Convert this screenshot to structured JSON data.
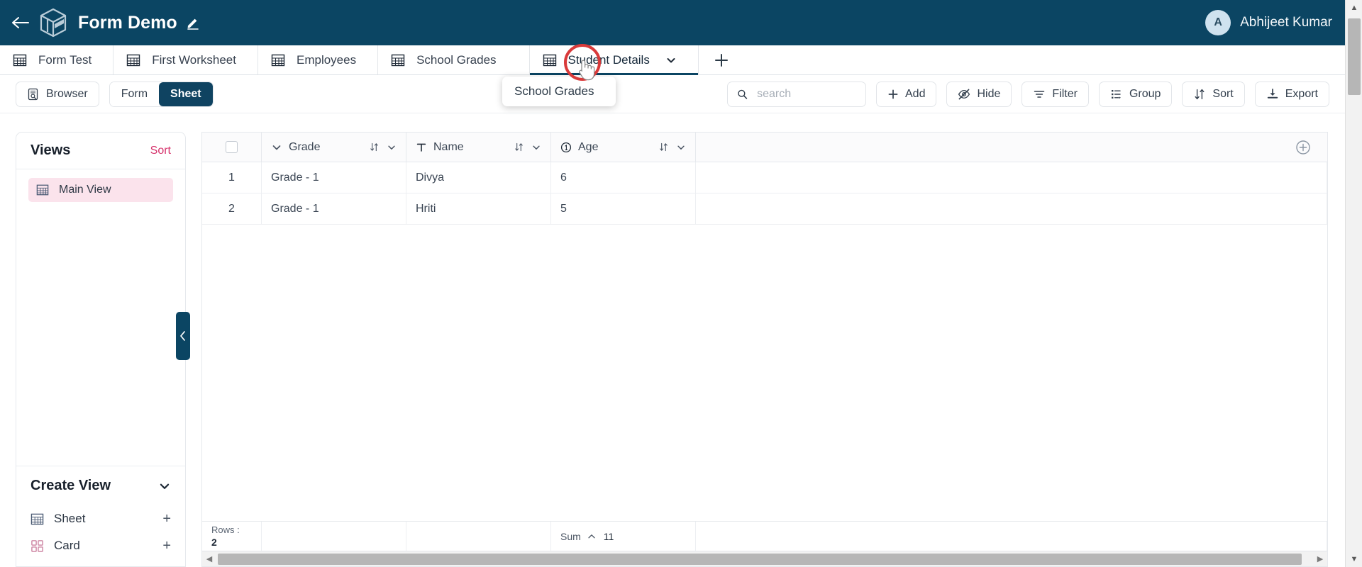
{
  "header": {
    "back_icon": "arrow-left-icon",
    "logo_icon": "cube-logo-icon",
    "title": "Form Demo",
    "edit_icon": "pencil-icon",
    "user": {
      "initial": "A",
      "name": "Abhijeet Kumar"
    },
    "bg_color": "#0b4563"
  },
  "tabs": {
    "items": [
      {
        "label": "Form Test",
        "icon": "table-icon",
        "active": false
      },
      {
        "label": "First Worksheet",
        "icon": "table-icon",
        "active": false
      },
      {
        "label": "Employees",
        "icon": "table-icon",
        "active": false
      },
      {
        "label": "School Grades",
        "icon": "table-icon",
        "active": false
      },
      {
        "label": "Student Details",
        "icon": "table-icon",
        "active": true
      }
    ],
    "add_label": "+",
    "tooltip": "School Grades"
  },
  "toolbar": {
    "browser_label": "Browser",
    "browser_icon": "browser-icon",
    "form_label": "Form",
    "sheet_label": "Sheet",
    "search": {
      "value": "",
      "placeholder": "search",
      "icon": "search-icon"
    },
    "actions": [
      {
        "label": "Add",
        "icon": "plus-icon"
      },
      {
        "label": "Hide",
        "icon": "eye-off-icon"
      },
      {
        "label": "Filter",
        "icon": "filter-icon"
      },
      {
        "label": "Group",
        "icon": "group-icon"
      },
      {
        "label": "Sort",
        "icon": "sort-icon"
      },
      {
        "label": "Export",
        "icon": "download-icon"
      }
    ]
  },
  "sidebar": {
    "views_title": "Views",
    "sort_label": "Sort",
    "views": [
      {
        "label": "Main View",
        "icon": "table-icon",
        "selected": true
      }
    ],
    "create_title": "Create View",
    "create_chevron": "chevron-down-icon",
    "create_items": [
      {
        "label": "Sheet",
        "icon": "table-icon",
        "add": "+"
      },
      {
        "label": "Card",
        "icon": "card-icon",
        "add": "+"
      }
    ],
    "collapse_icon": "chevron-left-icon",
    "accent_color": "#d6336c"
  },
  "grid": {
    "columns": [
      {
        "label": "Grade",
        "type_icon": "chevron-down-icon"
      },
      {
        "label": "Name",
        "type_icon": "text-T-icon"
      },
      {
        "label": "Age",
        "type_icon": "number-1-icon"
      }
    ],
    "add_column_icon": "plus-circle-icon",
    "sort_icon": "sort-arrows-icon",
    "menu_icon": "chevron-down-icon",
    "rows": [
      {
        "index": "1",
        "Grade": "Grade - 1",
        "Name": "Divya",
        "Age": "6"
      },
      {
        "index": "2",
        "Grade": "Grade - 1",
        "Name": "Hriti",
        "Age": "5"
      }
    ],
    "footer": {
      "rows_label": "Rows :",
      "rows_value": "2",
      "sum_label": "Sum",
      "sum_caret": "chevron-up-icon",
      "sum_value": "11"
    }
  }
}
